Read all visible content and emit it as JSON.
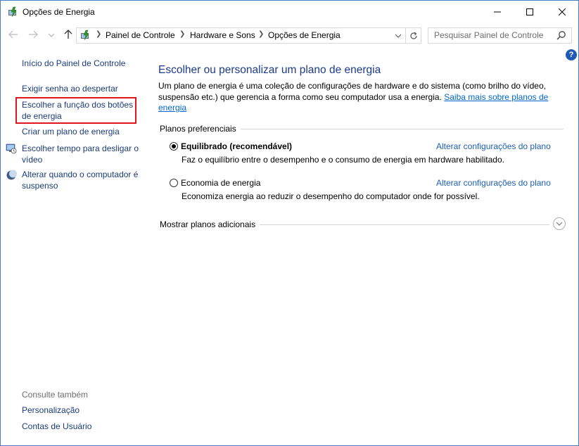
{
  "window": {
    "title": "Opções de Energia",
    "controls": {
      "minimize": "minimize",
      "maximize": "maximize",
      "close": "close"
    }
  },
  "navigation": {
    "breadcrumb": [
      "Painel de Controle",
      "Hardware e Sons",
      "Opções de Energia"
    ],
    "search_placeholder": "Pesquisar Painel de Controle"
  },
  "sidebar": {
    "home": "Início do Painel de Controle",
    "items": [
      {
        "label": "Exigir senha ao despertar",
        "icon": null
      },
      {
        "label": "Escolher a função dos botões de energia",
        "icon": null,
        "highlighted": true
      },
      {
        "label": "Criar um plano de energia",
        "icon": null
      },
      {
        "label": "Escolher tempo para desligar o vídeo",
        "icon": "monitor-clock-icon"
      },
      {
        "label": "Alterar quando o computador é suspenso",
        "icon": "moon-icon"
      }
    ],
    "see_also": {
      "title": "Consulte também",
      "links": [
        "Personalização",
        "Contas de Usuário"
      ]
    }
  },
  "main": {
    "title": "Escolher ou personalizar um plano de energia",
    "description": "Um plano de energia é uma coleção de configurações de hardware e do sistema (como brilho do vídeo, suspensão etc.) que gerencia a forma como seu computador usa a energia.",
    "learn_more": "Saiba mais sobre planos de energia",
    "preferred_plans_label": "Planos preferenciais",
    "plans": [
      {
        "name": "Equilibrado (recomendável)",
        "description": "Faz o equilíbrio entre o desempenho e o consumo de energia em hardware habilitado.",
        "selected": true,
        "change_link": "Alterar configurações do plano"
      },
      {
        "name": "Economia de energia",
        "description": "Economiza energia ao reduzir o desempenho do computador onde for possível.",
        "selected": false,
        "change_link": "Alterar configurações do plano"
      }
    ],
    "show_more": "Mostrar planos adicionais"
  },
  "colors": {
    "link": "#1c5fb3",
    "heading": "#1e3b8a",
    "highlight_border": "#e0161c",
    "help_icon": "#1f5bb5"
  }
}
